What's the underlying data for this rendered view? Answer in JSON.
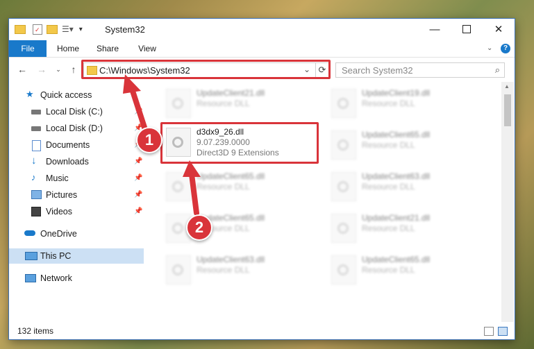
{
  "window": {
    "title": "System32"
  },
  "ribbon": {
    "tabs": [
      "File",
      "Home",
      "Share",
      "View"
    ]
  },
  "address": {
    "path": "C:\\Windows\\System32",
    "search_placeholder": "Search System32"
  },
  "sidebar": {
    "items": [
      {
        "label": "Quick access",
        "icon": "star-icon"
      },
      {
        "label": "Local Disk (C:)",
        "icon": "drive-icon"
      },
      {
        "label": "Local Disk (D:)",
        "icon": "drive-icon"
      },
      {
        "label": "Documents",
        "icon": "documents-icon"
      },
      {
        "label": "Downloads",
        "icon": "download-icon"
      },
      {
        "label": "Music",
        "icon": "music-icon"
      },
      {
        "label": "Pictures",
        "icon": "pictures-icon"
      },
      {
        "label": "Videos",
        "icon": "videos-icon"
      },
      {
        "label": "OneDrive",
        "icon": "cloud-icon"
      },
      {
        "label": "This PC",
        "icon": "computer-icon"
      },
      {
        "label": "Network",
        "icon": "network-icon"
      }
    ]
  },
  "files": {
    "highlight": {
      "name": "d3dx9_26.dll",
      "version": "9.07.239.0000",
      "description": "Direct3D 9 Extensions"
    },
    "background": [
      {
        "name": "UpdateClient21.dll",
        "type": "Resource DLL"
      },
      {
        "name": "UpdateClient19.dll",
        "type": "Resource DLL"
      },
      {
        "name": "UpdateClient65.dll",
        "type": "Resource DLL"
      },
      {
        "name": "UpdateClient65.dll",
        "type": "Resource DLL"
      },
      {
        "name": "UpdateClient63.dll",
        "type": "Resource DLL"
      },
      {
        "name": "UpdateClient65.dll",
        "type": "Resource DLL"
      },
      {
        "name": "UpdateClient21.dll",
        "type": "Resource DLL"
      },
      {
        "name": "UpdateClient63.dll",
        "type": "Resource DLL"
      },
      {
        "name": "UpdateClient65.dll",
        "type": "Resource DLL"
      }
    ]
  },
  "status": {
    "item_count": "132 items"
  },
  "annotations": {
    "step1": "1",
    "step2": "2"
  },
  "colors": {
    "accent": "#1979ca",
    "annotation_red": "#d9343a",
    "selection": "#cce0f4"
  }
}
